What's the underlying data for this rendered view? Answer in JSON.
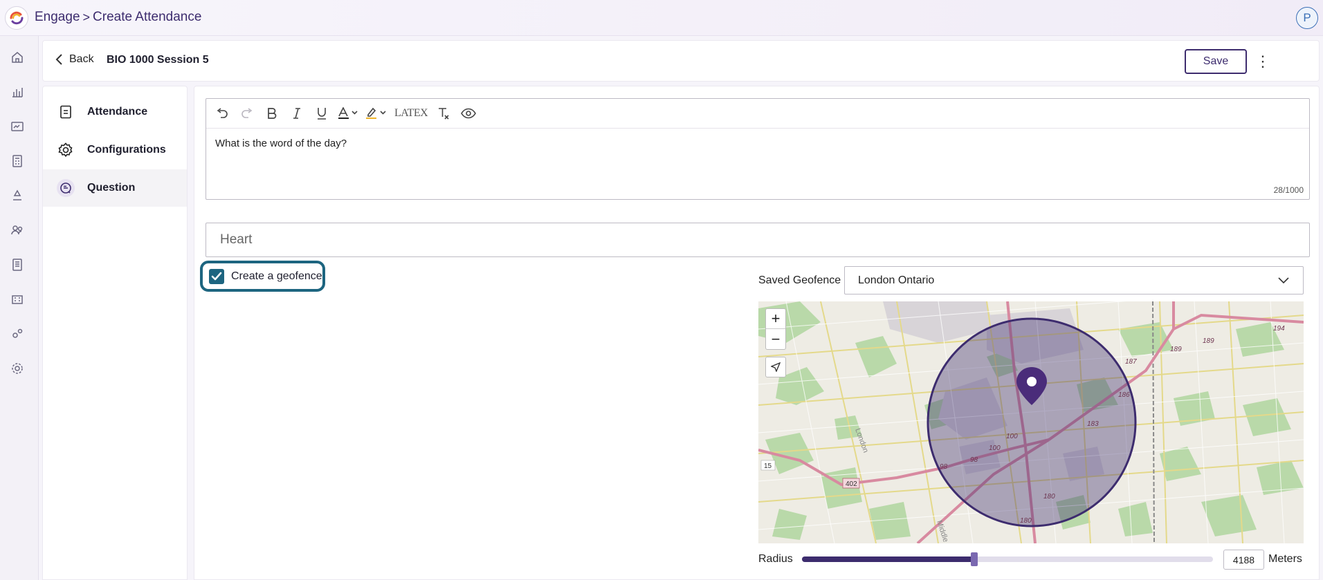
{
  "topbar": {
    "crumb_root": "Engage",
    "crumb_separator": ">",
    "crumb_current": "Create Attendance",
    "avatar_initial": "P"
  },
  "rail": {
    "icons": [
      "home-icon",
      "bar-chart-icon",
      "id-card-icon",
      "calculator-icon",
      "recycle-icon",
      "people-icon",
      "document-list-icon",
      "building-icon",
      "gears-icon",
      "settings-icon"
    ]
  },
  "header": {
    "back_label": "Back",
    "title": "BIO 1000 Session 5",
    "save_label": "Save",
    "more_label": "⋮"
  },
  "sidenav": {
    "items": [
      {
        "label": "Attendance",
        "icon": "document-icon",
        "active": false
      },
      {
        "label": "Configurations",
        "icon": "gear-icon",
        "active": false
      },
      {
        "label": "Question",
        "icon": "question-chat-icon",
        "active": true
      }
    ]
  },
  "editor": {
    "toolbar": [
      "undo",
      "redo",
      "bold",
      "italic",
      "underline",
      "text-color",
      "highlight",
      "latex",
      "clear-format",
      "preview"
    ],
    "latex_label": "LATEX",
    "text": "What is the word of the day?",
    "counter": "28/1000"
  },
  "answer": {
    "placeholder": "Heart"
  },
  "geofence": {
    "checkbox_label": "Create a geofence",
    "checked": true,
    "saved_label": "Saved Geofence",
    "saved_value": "London Ontario",
    "zoom_in": "+",
    "zoom_out": "−",
    "radius_label": "Radius",
    "radius_value": "4188",
    "radius_fraction": 0.42,
    "unit_label": "Meters"
  },
  "map": {
    "road_labels": [
      "194",
      "189",
      "189",
      "187",
      "186",
      "183",
      "100",
      "100",
      "98",
      "98",
      "180",
      "180",
      "15",
      "402",
      "London",
      "Middle"
    ],
    "colors": {
      "base": "#eeece4",
      "green": "#aed3a0",
      "road_major": "#d98aa0",
      "road_minor": "#e8de8c",
      "circle_fill": "#3d2c6e",
      "pin": "#4a2c7a"
    }
  },
  "colors": {
    "brand": "#3d2c6e",
    "teal": "#1d6580"
  }
}
